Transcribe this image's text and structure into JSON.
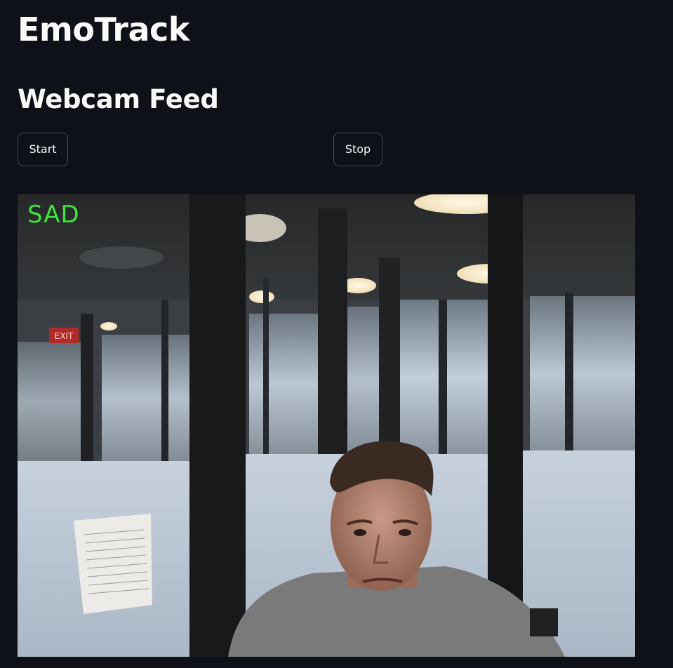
{
  "app": {
    "title": "EmoTrack"
  },
  "section": {
    "subheader": "Webcam Feed"
  },
  "controls": {
    "start_label": "Start",
    "stop_label": "Stop"
  },
  "feed": {
    "emotion_label": "SAD",
    "emotion_color": "#3fe33a",
    "exit_sign_text": "EXIT"
  },
  "theme": {
    "background": "#0e1117",
    "text": "#fafafa"
  }
}
